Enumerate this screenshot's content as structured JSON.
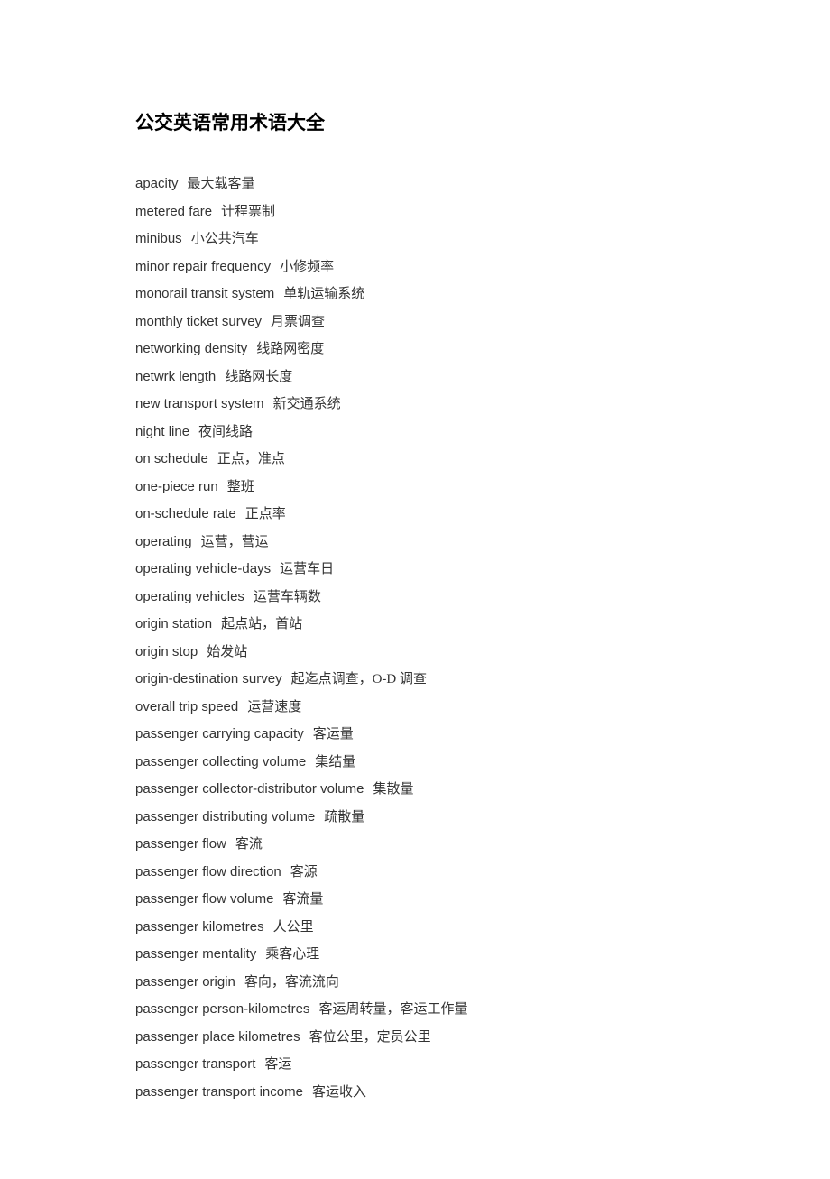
{
  "title": "公交英语常用术语大全",
  "entries": [
    {
      "en": "apacity",
      "zh": "最大载客量"
    },
    {
      "en": "metered fare",
      "zh": "计程票制"
    },
    {
      "en": "minibus",
      "zh": "小公共汽车"
    },
    {
      "en": "minor repair frequency",
      "zh": "小修频率"
    },
    {
      "en": "monorail transit system",
      "zh": "单轨运输系统"
    },
    {
      "en": "monthly ticket survey",
      "zh": "月票调查"
    },
    {
      "en": "networking density",
      "zh": "线路网密度"
    },
    {
      "en": "netwrk length",
      "zh": "线路网长度"
    },
    {
      "en": "new transport system",
      "zh": "新交通系统"
    },
    {
      "en": "night line",
      "zh": "夜间线路"
    },
    {
      "en": "on schedule",
      "zh": "正点，准点"
    },
    {
      "en": "one-piece run",
      "zh": "整班"
    },
    {
      "en": "on-schedule rate",
      "zh": "正点率"
    },
    {
      "en": "operating",
      "zh": "运营，营运"
    },
    {
      "en": "operating vehicle-days",
      "zh": "运营车日"
    },
    {
      "en": "operating vehicles",
      "zh": "运营车辆数"
    },
    {
      "en": "origin station",
      "zh": "起点站，首站"
    },
    {
      "en": "origin stop",
      "zh": "始发站"
    },
    {
      "en": "origin-destination survey",
      "zh": "起迄点调查，O-D 调查"
    },
    {
      "en": "overall trip speed",
      "zh": "运营速度"
    },
    {
      "en": "passenger carrying capacity",
      "zh": "客运量"
    },
    {
      "en": "passenger collecting volume",
      "zh": "集结量"
    },
    {
      "en": "passenger collector-distributor volume",
      "zh": "集散量"
    },
    {
      "en": "passenger distributing volume",
      "zh": "疏散量"
    },
    {
      "en": "passenger flow",
      "zh": "客流"
    },
    {
      "en": "passenger flow direction",
      "zh": "客源"
    },
    {
      "en": "passenger flow volume",
      "zh": "客流量"
    },
    {
      "en": "passenger kilometres",
      "zh": "人公里"
    },
    {
      "en": "passenger mentality",
      "zh": "乘客心理"
    },
    {
      "en": "passenger origin",
      "zh": "客向，客流流向"
    },
    {
      "en": "passenger person-kilometres",
      "zh": "客运周转量，客运工作量"
    },
    {
      "en": "passenger place kilometres",
      "zh": "客位公里，定员公里"
    },
    {
      "en": "passenger transport",
      "zh": "客运"
    },
    {
      "en": "passenger transport income",
      "zh": "客运收入"
    }
  ]
}
